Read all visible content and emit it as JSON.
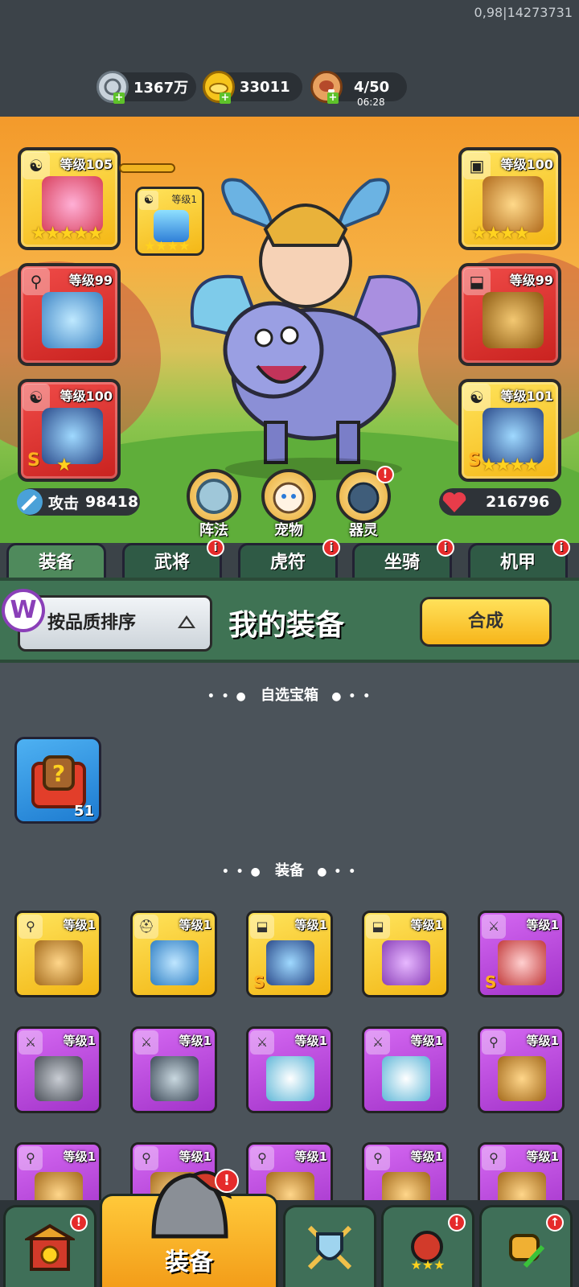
{
  "debug_text": "0,98|14273731",
  "resources": {
    "silver": "1367万",
    "gold": "33011",
    "stamina": "4/50",
    "stamina_timer": "06:28"
  },
  "equipment_slots": {
    "left_top_level": "等级105",
    "mini_level": "等级1",
    "left_mid_level": "等级99",
    "left_bottom_level": "等级100",
    "right_top_level": "等级100",
    "right_mid_level": "等级99",
    "right_bottom_level": "等级101",
    "s_grade": "S"
  },
  "stats": {
    "attack_label": "攻击",
    "attack_value": "98418",
    "hp_value": "216796"
  },
  "round_buttons": {
    "formation": "阵法",
    "pet": "宠物",
    "spirit": "器灵"
  },
  "tabs": [
    "装备",
    "武将",
    "虎符",
    "坐骑",
    "机甲"
  ],
  "panel": {
    "sort_label": "按品质排序",
    "title": "我的装备",
    "synth_label": "合成",
    "logo_letter": "W"
  },
  "sections": {
    "chest_title": "自选宝箱",
    "equip_title": "装备",
    "chest_count": "51"
  },
  "grid_level": "等级1",
  "bottom_nav": {
    "active_label": "装备"
  },
  "colors": {
    "gold_card": "#f4b716",
    "red_card": "#c9221f",
    "purple_card": "#a233c9",
    "tab_green": "#2f5a45"
  }
}
